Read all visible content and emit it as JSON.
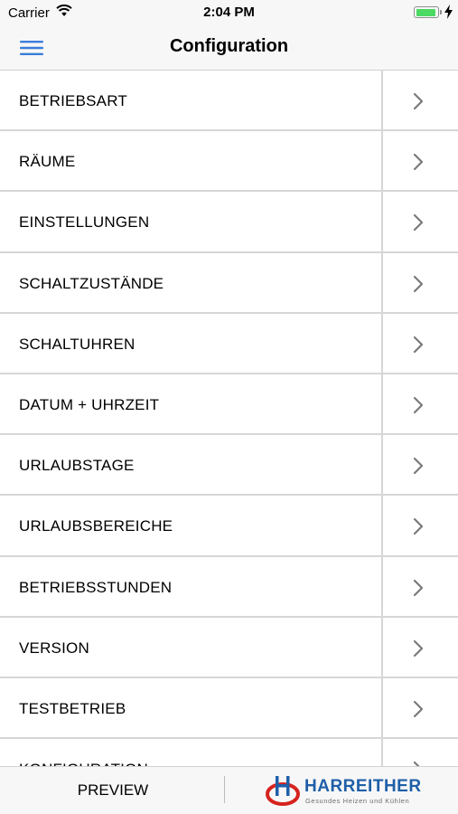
{
  "status_bar": {
    "carrier": "Carrier",
    "time": "2:04 PM",
    "battery_level": 0.95
  },
  "nav": {
    "title": "Configuration",
    "menu_icon": "hamburger-menu-icon"
  },
  "menu_items": [
    {
      "label": "BETRIEBSART"
    },
    {
      "label": "RÄUME"
    },
    {
      "label": "EINSTELLUNGEN"
    },
    {
      "label": "SCHALTZUSTÄNDE"
    },
    {
      "label": "SCHALTUHREN"
    },
    {
      "label": "DATUM + UHRZEIT"
    },
    {
      "label": "URLAUBSTAGE"
    },
    {
      "label": "URLAUBSBEREICHE"
    },
    {
      "label": "BETRIEBSSTUNDEN"
    },
    {
      "label": "VERSION"
    },
    {
      "label": "TESTBETRIEB"
    },
    {
      "label": "KONFIGURATION"
    }
  ],
  "footer": {
    "preview_label": "PREVIEW",
    "logo_text": "HARREITHER",
    "logo_subtitle": "Gesundes Heizen und Kühlen",
    "logo_mark": "H"
  },
  "colors": {
    "accent": "#3a7ddb",
    "logo_blue": "#1f5fa8",
    "logo_red": "#d6231f",
    "battery_green": "#4cd964"
  }
}
